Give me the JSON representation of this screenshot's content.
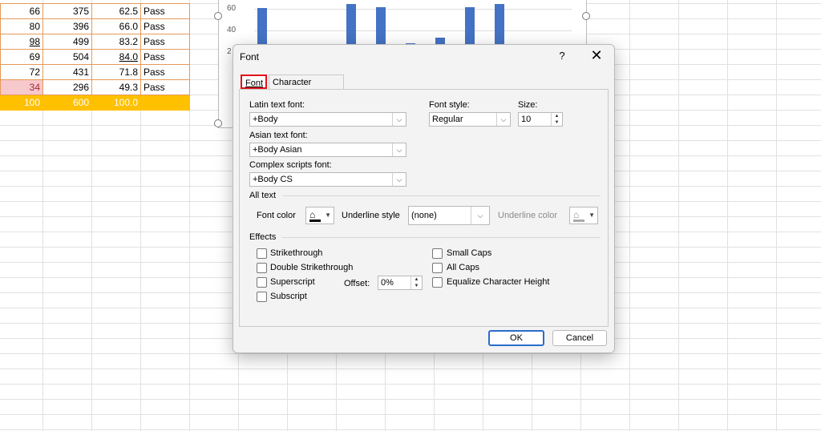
{
  "sheet": {
    "rows": [
      {
        "a": "66",
        "b": "375",
        "c": "62.5",
        "d": "Pass"
      },
      {
        "a": "80",
        "b": "396",
        "c": "66.0",
        "d": "Pass"
      },
      {
        "a": "98",
        "b": "499",
        "c": "83.2",
        "d": "Pass"
      },
      {
        "a": "69",
        "b": "504",
        "c": "84.0",
        "d": "Pass"
      },
      {
        "a": "72",
        "b": "431",
        "c": "71.8",
        "d": "Pass"
      },
      {
        "a": "34",
        "b": "296",
        "c": "49.3",
        "d": "Pass"
      }
    ],
    "total": {
      "a": "100",
      "b": "600",
      "c": "100.0",
      "d": ""
    }
  },
  "chart_data": {
    "type": "bar",
    "y_ticks": [
      "60",
      "40",
      "2"
    ],
    "values": [
      85,
      40,
      45,
      88,
      86,
      60,
      64,
      86,
      88,
      47
    ],
    "color": "#4472c4"
  },
  "dialog": {
    "title": "Font",
    "help": "?",
    "close": "✕",
    "tabs": {
      "font": "Font",
      "char_spacing": "Character Spacing"
    },
    "latin_label": "Latin text font:",
    "latin_value": "+Body",
    "asian_label": "Asian text font:",
    "asian_value": "+Body Asian",
    "complex_label": "Complex scripts font:",
    "complex_value": "+Body CS",
    "style_label": "Font style:",
    "style_value": "Regular",
    "size_label": "Size:",
    "size_value": "10",
    "all_text": "All text",
    "font_color_label": "Font color",
    "underline_style_label": "Underline style",
    "underline_style_value": "(none)",
    "underline_color_label": "Underline color",
    "effects": "Effects",
    "effects_left": [
      "Strikethrough",
      "Double Strikethrough",
      "Superscript",
      "Subscript"
    ],
    "effects_right": [
      "Small Caps",
      "All Caps",
      "Equalize Character Height"
    ],
    "offset_label": "Offset:",
    "offset_value": "0%",
    "ok": "OK",
    "cancel": "Cancel"
  }
}
